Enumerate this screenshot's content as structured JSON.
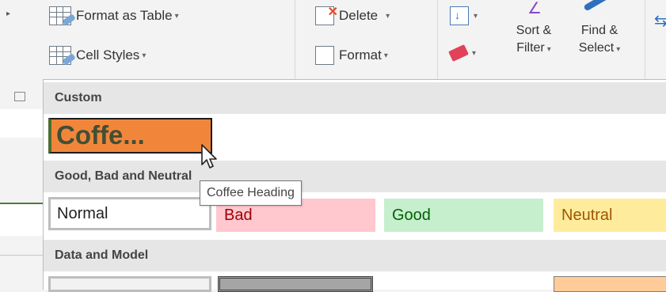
{
  "ribbon": {
    "format_as_table": "Format as Table",
    "cell_styles": "Cell Styles",
    "delete": "Delete",
    "format": "Format",
    "sort_filter_line1": "Sort &",
    "sort_filter_line2": "Filter",
    "find_select_line1": "Find &",
    "find_select_line2": "Select",
    "caret": "▾"
  },
  "gallery": {
    "sections": {
      "custom": "Custom",
      "good_bad_neutral": "Good, Bad and Neutral",
      "data_model": "Data and Model"
    },
    "custom_styles": [
      {
        "label": "Coffe...",
        "style": "Coffee Heading"
      }
    ],
    "good_bad_neutral_styles": [
      "Normal",
      "Bad",
      "Good",
      "Neutral"
    ],
    "colors": {
      "coffee_fill": "#f1863a",
      "bad_fill": "#ffc7ce",
      "good_fill": "#c6efce",
      "neutral_fill": "#ffeb9c"
    }
  },
  "tooltip": {
    "text": "Coffee Heading"
  }
}
